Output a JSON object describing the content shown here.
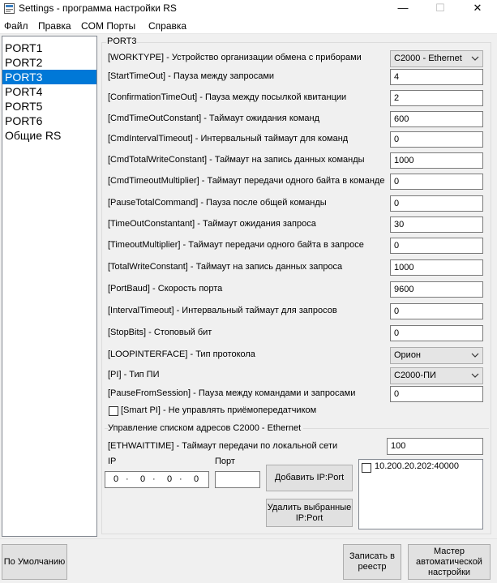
{
  "window": {
    "title": "Settings - программа настройки RS",
    "min": "—",
    "max": "☐",
    "close": "✕"
  },
  "menu": [
    "Файл",
    "Правка",
    "COM Порты",
    "Справка"
  ],
  "ports": [
    "PORT1",
    "PORT2",
    "PORT3",
    "PORT4",
    "PORT5",
    "PORT6",
    "Общие RS"
  ],
  "selected_port": "PORT3",
  "group_title": "PORT3",
  "params": [
    {
      "key": "[WORKTYPE]",
      "desc": "  - Устройство организации обмена с приборами",
      "value": "C2000 - Ethernet",
      "kind": "combo"
    },
    {
      "key": "[StartTimeOut]",
      "desc": "  - Пауза между запросами",
      "value": "4",
      "kind": "text"
    },
    {
      "key": "[ConfirmationTimeOut]",
      "desc": " - Пауза между посылкой квитанции",
      "value": "2",
      "kind": "text"
    },
    {
      "key": "[CmdTimeOutConstant]",
      "desc": " - Таймаут ожидания команд",
      "value": "600",
      "kind": "text"
    },
    {
      "key": "[CmdIntervalTimeout]",
      "desc": " - Интервальный таймаут для команд",
      "value": "0",
      "kind": "text"
    },
    {
      "key": "[CmdTotalWriteConstant]",
      "desc": " - Таймаут на запись данных команды",
      "value": "1000",
      "kind": "text"
    },
    {
      "key": "[CmdTimeoutMultiplier]",
      "desc": " - Таймаут передачи одного байта в команде",
      "value": "0",
      "kind": "text"
    },
    {
      "key": "[PauseTotalCommand]",
      "desc": " - Пауза после общей команды",
      "value": "0",
      "kind": "text"
    },
    {
      "key": "[TimeOutConstantant]",
      "desc": " - Таймаут ожидания запроса",
      "value": "30",
      "kind": "text"
    },
    {
      "key": "[TimeoutMultiplier]",
      "desc": " - Таймаут передачи одного байта в запросе",
      "value": "0",
      "kind": "text"
    },
    {
      "key": "[TotalWriteConstant]",
      "desc": " - Таймаут на запись данных запроса",
      "value": "1000",
      "kind": "text"
    },
    {
      "key": "[PortBaud]",
      "desc": " - Скорость порта",
      "value": "9600",
      "kind": "text"
    },
    {
      "key": "[IntervalTimeout]",
      "desc": " - Интервальный таймаут для запросов",
      "value": "0",
      "kind": "text"
    },
    {
      "key": "[StopBits]",
      "desc": " - Стоповый бит",
      "value": "0",
      "kind": "text"
    },
    {
      "key": "[LOOPINTERFACE]",
      "desc": " - Тип протокола",
      "value": "Орион",
      "kind": "combo"
    },
    {
      "key": "[PI]",
      "desc": " - Тип ПИ",
      "value": "C2000-ПИ",
      "kind": "combo"
    },
    {
      "key": "[PauseFromSession]",
      "desc": " - Пауза между командами и запросами",
      "value": "0",
      "kind": "text"
    }
  ],
  "smart_pi": {
    "label": "[Smart PI] - Не управлять приёмопередатчиком",
    "checked": false
  },
  "ethernet": {
    "section_title": "Управление списком адресов С2000 - Ethernet",
    "ethwait_label": "[ETHWAITTIME] - Таймаут передачи по локальной сети",
    "ethwait_value": "100",
    "ip_label": "IP",
    "port_label": "Порт",
    "ip_octets": [
      "0",
      "0",
      "0",
      "0"
    ],
    "ip_separator": "·",
    "port_value": "",
    "add_button": "Добавить IP:Port",
    "delete_button": "Удалить выбранные IP:Port",
    "addresses": [
      {
        "text": "10.200.20.202:40000",
        "checked": false
      }
    ]
  },
  "bottom": {
    "default_button": "По Умолчанию",
    "save_button": "Записать в реестр",
    "wizard_button": "Мастер автоматической настройки"
  },
  "colors": {
    "selection": "#0078d7",
    "window_bg": "#f0f0f0"
  }
}
